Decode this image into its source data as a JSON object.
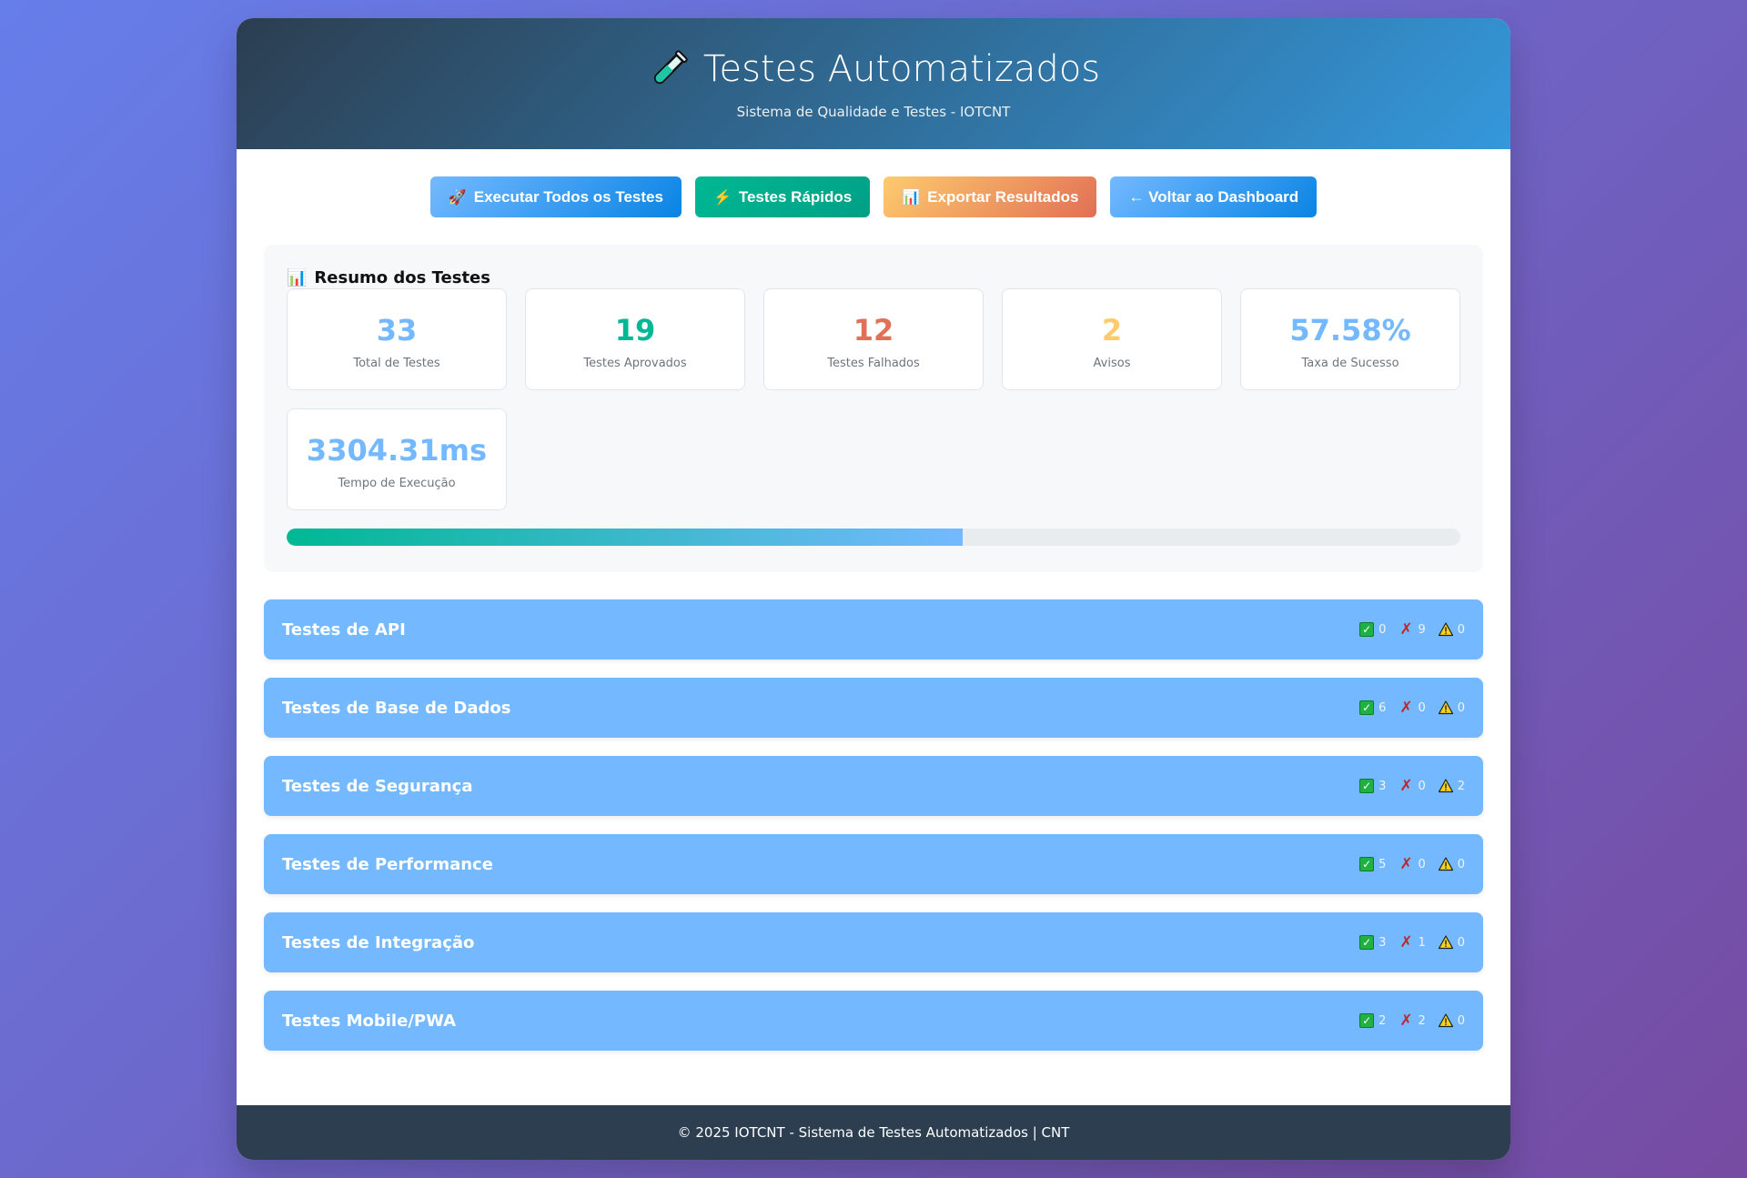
{
  "header": {
    "title": "Testes Automatizados",
    "subtitle": "Sistema de Qualidade e Testes - IOTCNT",
    "icon": "test-tube-icon"
  },
  "toolbar": {
    "run_all": {
      "icon": "🚀",
      "label": "Executar Todos os Testes"
    },
    "quick": {
      "icon": "⚡",
      "label": "Testes Rápidos"
    },
    "export": {
      "icon": "📊",
      "label": "Exportar Resultados"
    },
    "back": {
      "label": "← Voltar ao Dashboard"
    }
  },
  "summary": {
    "icon": "📊",
    "title": "Resumo dos Testes",
    "stats": [
      {
        "value": "33",
        "label": "Total de Testes",
        "color": "#74b9ff"
      },
      {
        "value": "19",
        "label": "Testes Aprovados",
        "color": "#00b894"
      },
      {
        "value": "12",
        "label": "Testes Falhados",
        "color": "#e17055"
      },
      {
        "value": "2",
        "label": "Avisos",
        "color": "#fdcb6e"
      },
      {
        "value": "57.58%",
        "label": "Taxa de Sucesso",
        "color": "#74b9ff"
      },
      {
        "value": "3304.31ms",
        "label": "Tempo de Execução",
        "color": "#74b9ff"
      }
    ],
    "progress_percent": 57.58
  },
  "suites": [
    {
      "title": "Testes de API",
      "passed": "0",
      "failed": "9",
      "warnings": "0"
    },
    {
      "title": "Testes de Base de Dados",
      "passed": "6",
      "failed": "0",
      "warnings": "0"
    },
    {
      "title": "Testes de Segurança",
      "passed": "3",
      "failed": "0",
      "warnings": "2"
    },
    {
      "title": "Testes de Performance",
      "passed": "5",
      "failed": "0",
      "warnings": "0"
    },
    {
      "title": "Testes de Integração",
      "passed": "3",
      "failed": "1",
      "warnings": "0"
    },
    {
      "title": "Testes Mobile/PWA",
      "passed": "2",
      "failed": "2",
      "warnings": "0"
    }
  ],
  "footer": {
    "text": "© 2025 IOTCNT - Sistema de Testes Automatizados | CNT"
  }
}
